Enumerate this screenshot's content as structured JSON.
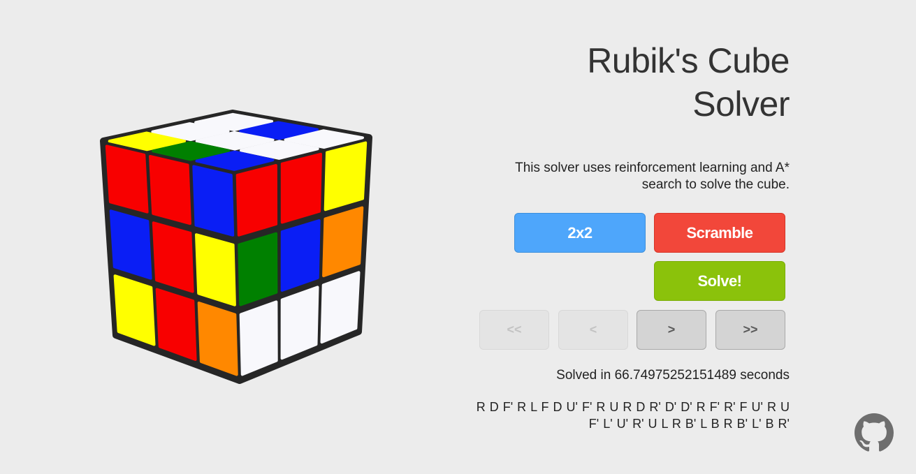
{
  "title": {
    "line1": "Rubik's Cube",
    "line2": "Solver"
  },
  "description": {
    "line1": "This solver uses reinforcement learning and A*",
    "line2": "search to solve the cube."
  },
  "buttons": {
    "size_label": "2x2",
    "scramble_label": "Scramble",
    "solve_label": "Solve!"
  },
  "navigation": {
    "first_label": "<<",
    "prev_label": "<",
    "next_label": ">",
    "last_label": ">>"
  },
  "status": {
    "solved_text": "Solved in 66.74975252151489 seconds"
  },
  "solution": {
    "line1": "R D F' R L F D U' F' R U R D R' D' D' R F' R' F U' R U",
    "line2": "F' L' U' R' U L R B' L B R B' L' B R'"
  },
  "cube": {
    "top": [
      [
        "white",
        "blue",
        "white"
      ],
      [
        "white",
        "white",
        "white"
      ],
      [
        "yellow",
        "green",
        "blue"
      ]
    ],
    "front": [
      [
        "red",
        "red",
        "blue"
      ],
      [
        "blue",
        "red",
        "yellow"
      ],
      [
        "yellow",
        "red",
        "orange"
      ]
    ],
    "right": [
      [
        "red",
        "red",
        "yellow"
      ],
      [
        "green",
        "blue",
        "orange"
      ],
      [
        "white",
        "white",
        "white"
      ]
    ]
  },
  "colors": {
    "white": "#f8f8fc",
    "blue": "#0a1ef5",
    "red": "#f80000",
    "yellow": "#ffff00",
    "green": "#008000",
    "orange": "#ff8800",
    "cube_body": "#262626",
    "button_blue": "#4ea6fb",
    "button_red": "#f2473a",
    "button_green": "#8bc20b"
  },
  "icons": {
    "github": "github-icon"
  }
}
